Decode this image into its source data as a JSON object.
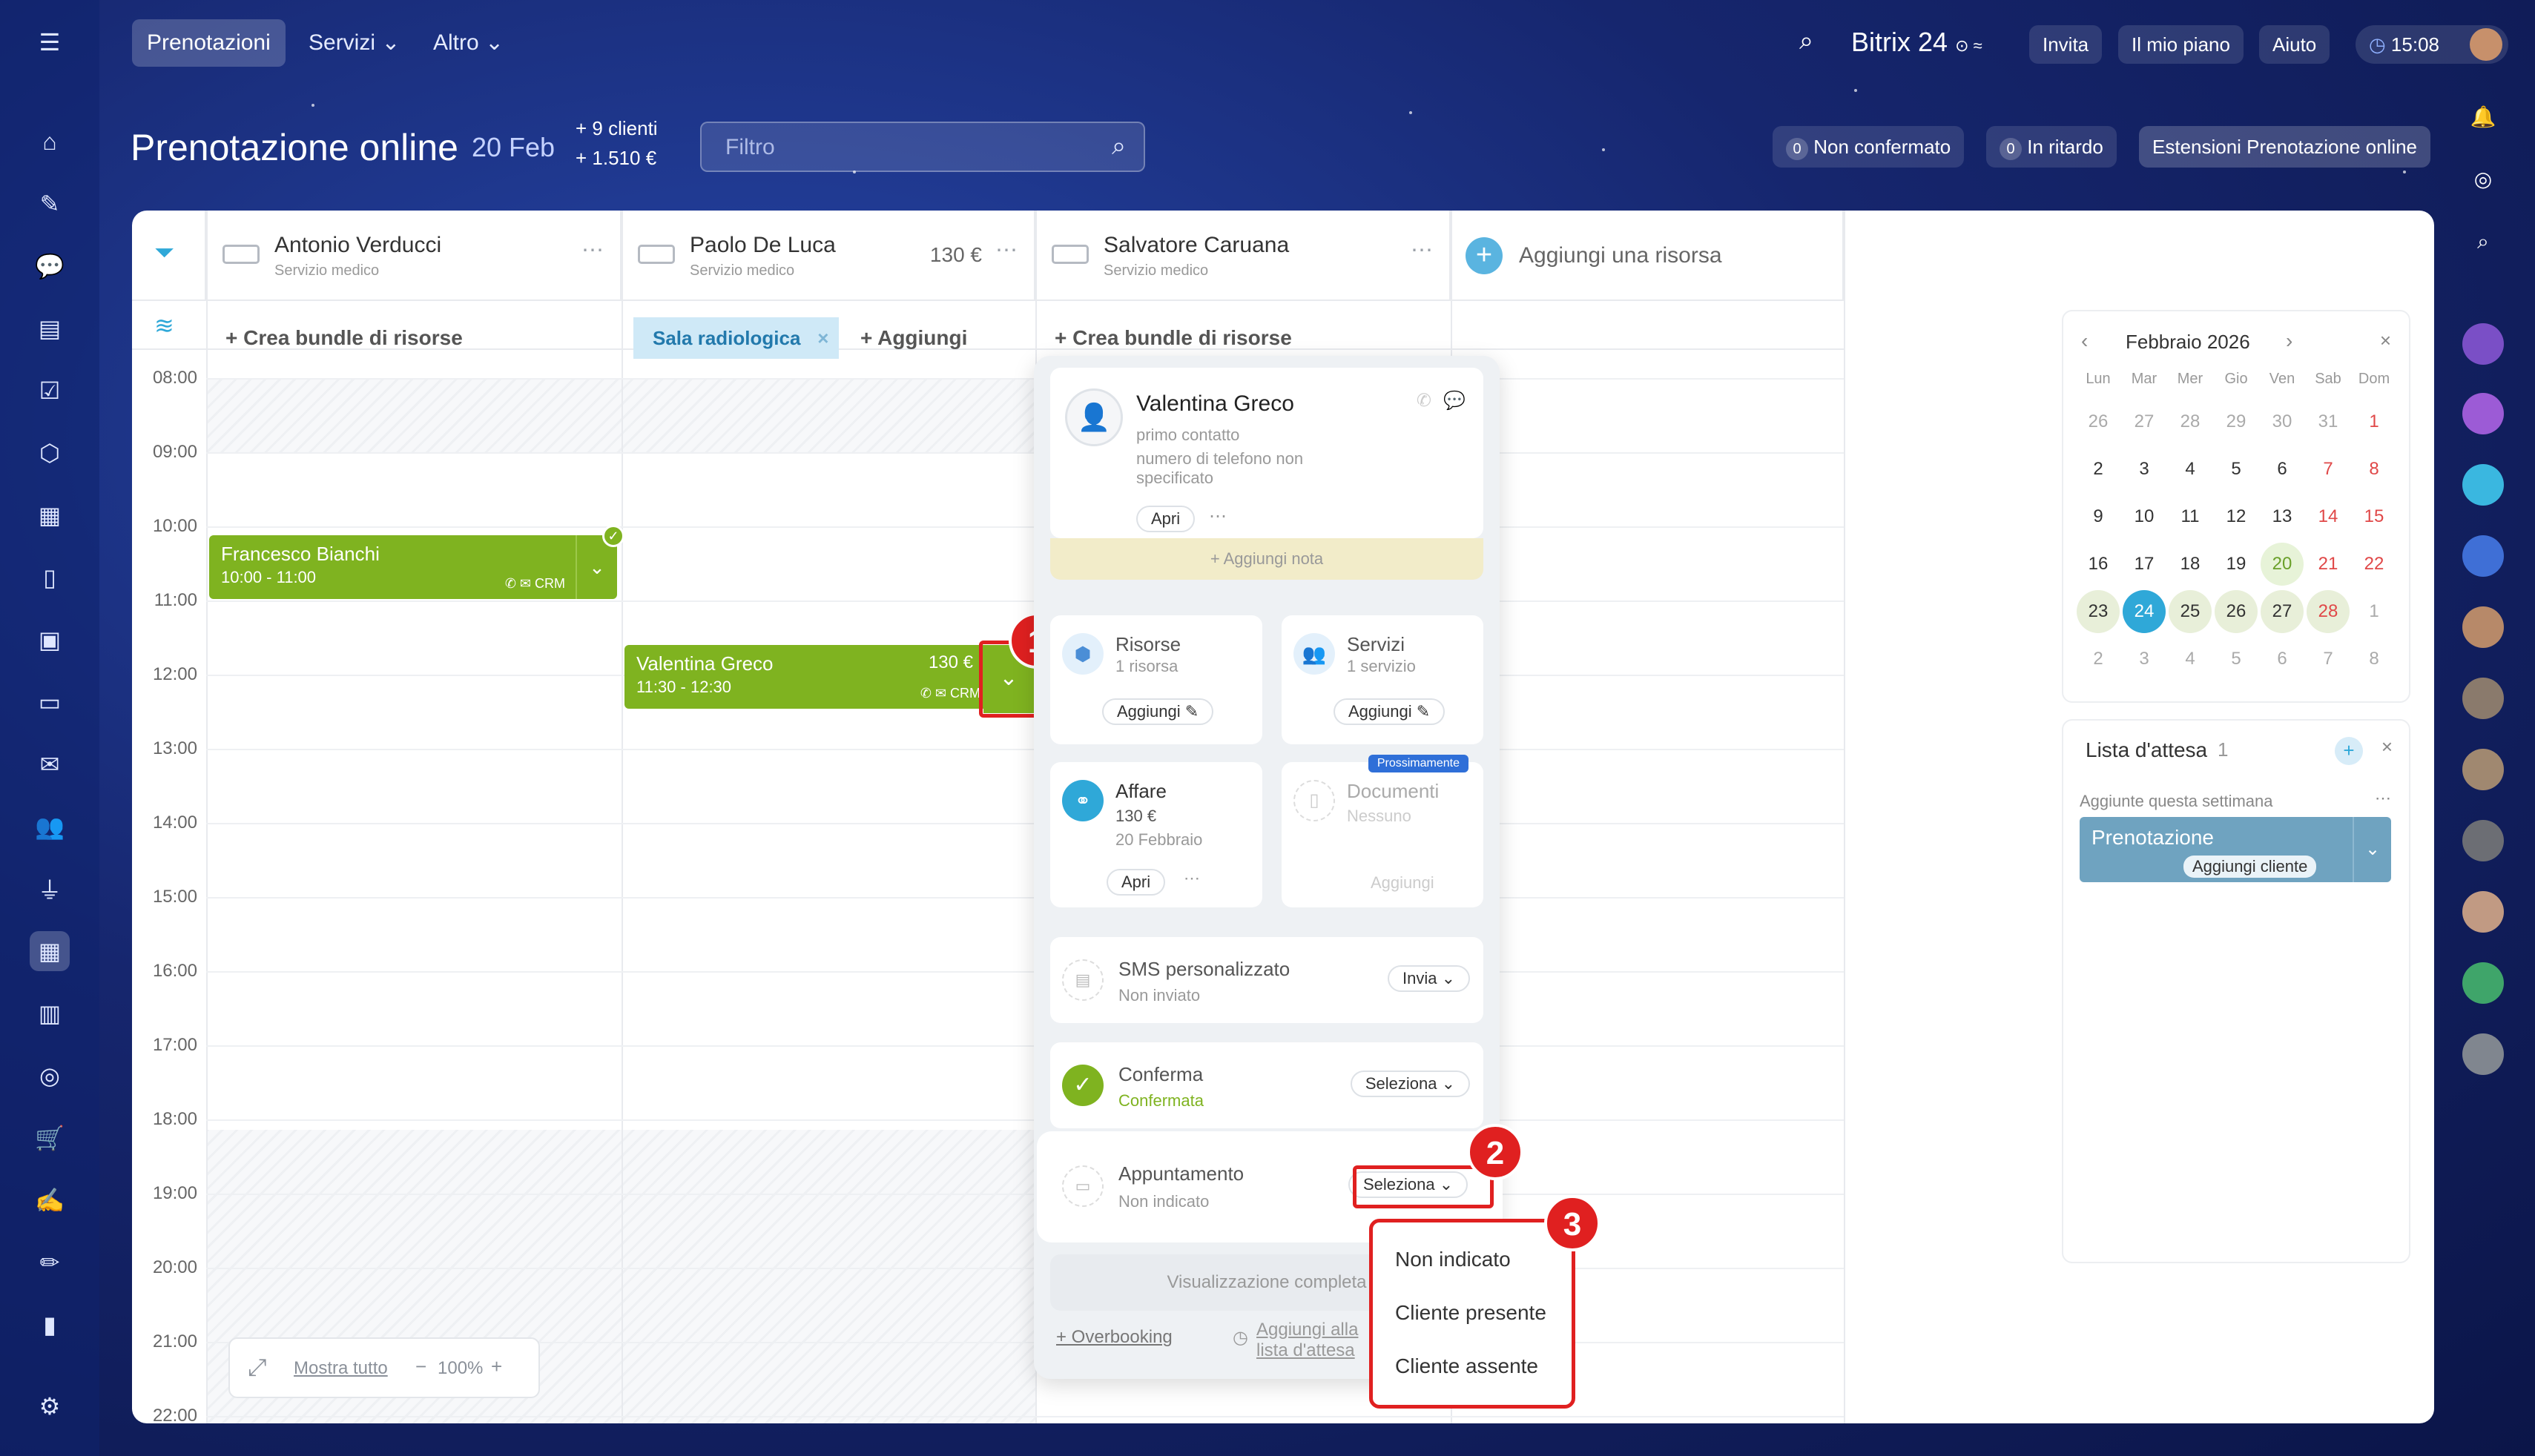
{
  "topbar": {
    "nav": [
      "Prenotazioni",
      "Servizi",
      "Altro"
    ],
    "brand": "Bitrix 24",
    "invite": "Invita",
    "plan": "Il mio piano",
    "help": "Aiuto",
    "time": "15:08"
  },
  "header": {
    "title": "Prenotazione online",
    "date": "20 Feb",
    "clients": "+ 9 clienti",
    "amount": "+ 1.510 €",
    "filter_placeholder": "Filtro",
    "unconfirmed_count": "0",
    "unconfirmed_label": "Non confermato",
    "late_count": "0",
    "late_label": "In ritardo",
    "extensions": "Estensioni Prenotazione online"
  },
  "resources": [
    {
      "name": "Antonio Verducci",
      "role": "Servizio medico",
      "price": ""
    },
    {
      "name": "Paolo De Luca",
      "role": "Servizio medico",
      "price": "130 €"
    },
    {
      "name": "Salvatore Caruana",
      "role": "Servizio medico",
      "price": ""
    }
  ],
  "add_resource": "Aggiungi una risorsa",
  "bundle_label": "+ Crea bundle di risorse",
  "room_tag": "Sala radiologica",
  "room_add": "+ Aggiungi",
  "hours": [
    "08:00",
    "09:00",
    "10:00",
    "11:00",
    "12:00",
    "13:00",
    "14:00",
    "15:00",
    "16:00",
    "17:00",
    "18:00",
    "19:00",
    "20:00",
    "21:00",
    "22:00"
  ],
  "events": [
    {
      "name": "Francesco Bianchi",
      "time": "10:00 - 11:00",
      "crm": "CRM"
    },
    {
      "name": "Valentina Greco",
      "time": "11:30 - 12:30",
      "price": "130 €",
      "crm": "CRM"
    }
  ],
  "footer": {
    "show_all": "Mostra tutto",
    "zoom": "100%",
    "minus": "−",
    "plus": "+"
  },
  "popup": {
    "client_name": "Valentina Greco",
    "client_line1": "primo contatto",
    "client_line2": "numero di telefono non specificato",
    "open": "Apri",
    "add_note": "+ Aggiungi nota",
    "resources_title": "Risorse",
    "resources_sub": "1 risorsa",
    "services_title": "Servizi",
    "services_sub": "1 servizio",
    "add": "Aggiungi",
    "deal_title": "Affare",
    "deal_amount": "130 €",
    "deal_date": "20 Febbraio",
    "soon_badge": "Prossimamente",
    "docs_title": "Documenti",
    "docs_sub": "Nessuno",
    "sms_title": "SMS personalizzato",
    "sms_sub": "Non inviato",
    "send": "Invia",
    "confirm_title": "Conferma",
    "confirm_sub": "Confermata",
    "select": "Seleziona",
    "appointment_title": "Appuntamento",
    "appointment_sub": "Non indicato",
    "full_view": "Visualizzazione completa",
    "overbooking": "+ Overbooking",
    "add_wait": "Aggiungi alla lista d'attesa"
  },
  "dropdown": [
    "Non indicato",
    "Cliente presente",
    "Cliente assente"
  ],
  "badges": [
    "1",
    "2",
    "3"
  ],
  "calendar": {
    "month": "Febbraio 2026",
    "weekdays": [
      "Lun",
      "Mar",
      "Mer",
      "Gio",
      "Ven",
      "Sab",
      "Dom"
    ],
    "weeks": [
      [
        "26",
        "27",
        "28",
        "29",
        "30",
        "31",
        "1"
      ],
      [
        "2",
        "3",
        "4",
        "5",
        "6",
        "7",
        "8"
      ],
      [
        "9",
        "10",
        "11",
        "12",
        "13",
        "14",
        "15"
      ],
      [
        "16",
        "17",
        "18",
        "19",
        "20",
        "21",
        "22"
      ],
      [
        "23",
        "24",
        "25",
        "26",
        "27",
        "28",
        "1"
      ],
      [
        "2",
        "3",
        "4",
        "5",
        "6",
        "7",
        "8"
      ]
    ],
    "today": "24",
    "accent": "#2fa8d8"
  },
  "waitlist": {
    "title": "Lista d'attesa",
    "count": "1",
    "section": "Aggiunte questa settimana",
    "item": "Prenotazione",
    "add_client": "Aggiungi cliente"
  }
}
